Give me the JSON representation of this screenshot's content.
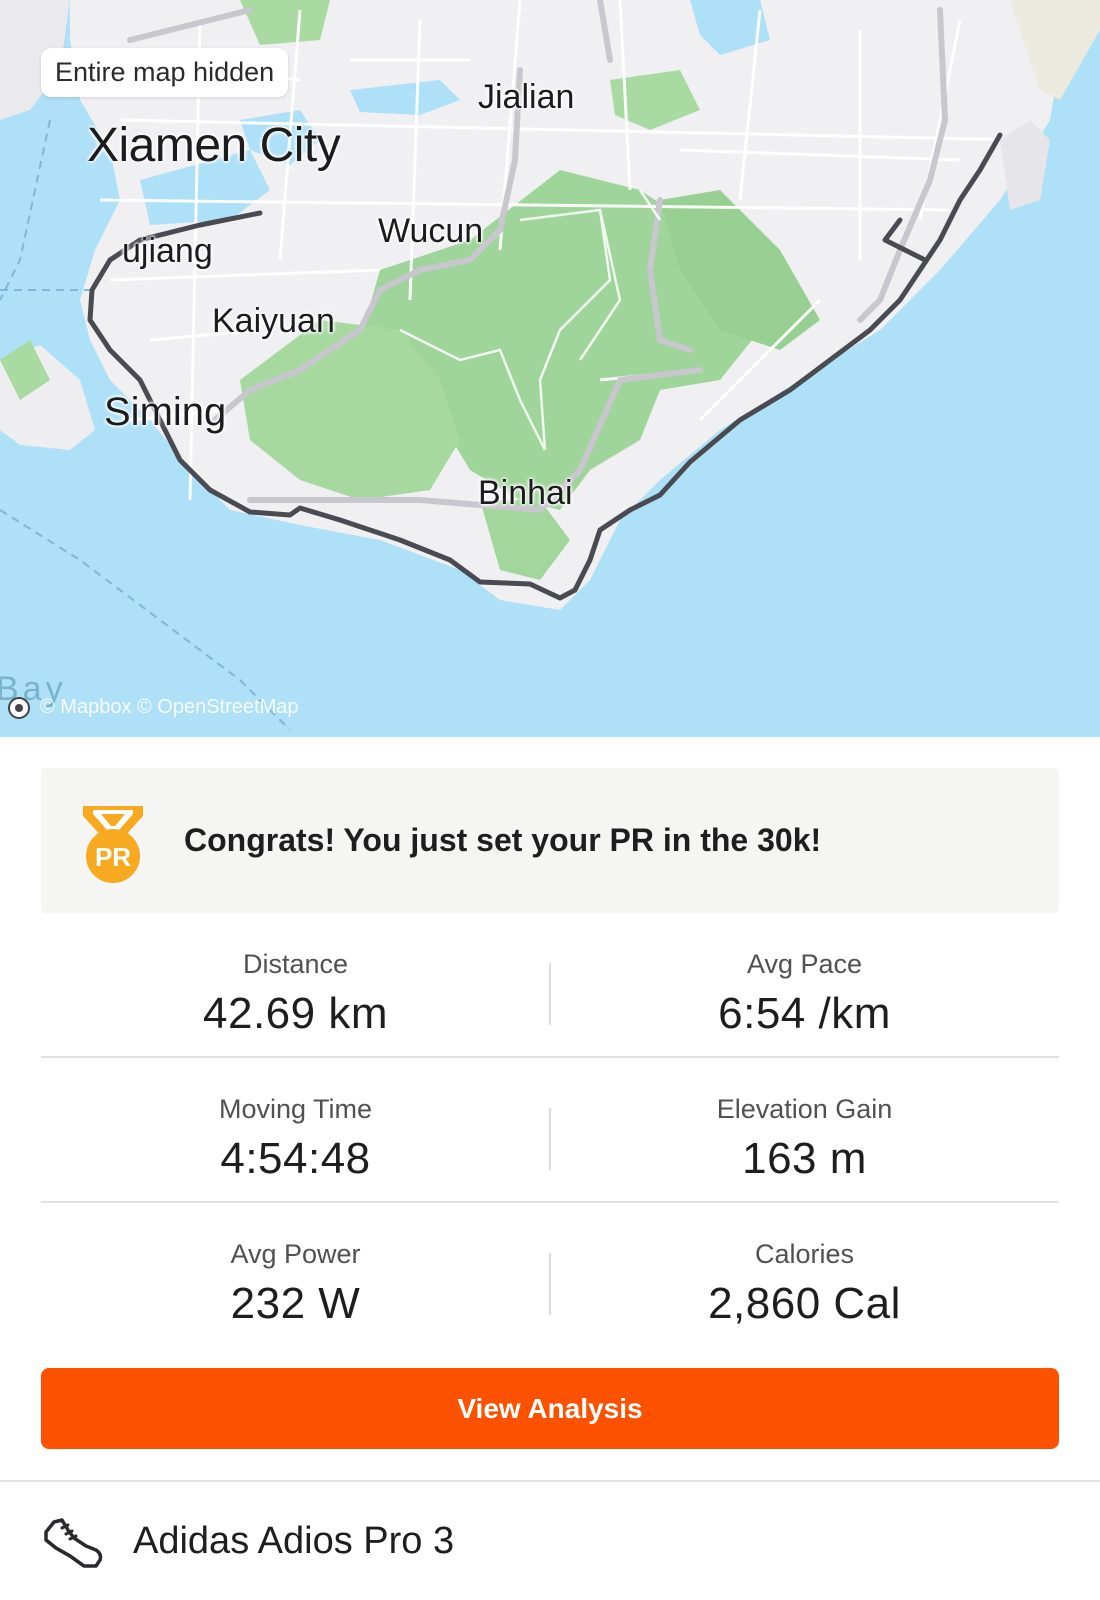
{
  "map": {
    "privacy_chip": "Entire map hidden",
    "labels": {
      "city": "Xiamen City",
      "jialian": "Jialian",
      "wucun": "Wucun",
      "lujiang": "ujiang",
      "kaiyuan": "Kaiyuan",
      "siming": "Siming",
      "binhai": "Binhai",
      "bay": "Bay"
    },
    "attribution": "© Mapbox © OpenStreetMap"
  },
  "pr_banner": {
    "medal_text": "PR",
    "message": "Congrats! You just set your PR in the 30k!"
  },
  "stats": [
    {
      "label": "Distance",
      "value": "42.69 km"
    },
    {
      "label": "Avg Pace",
      "value": "6:54 /km"
    },
    {
      "label": "Moving Time",
      "value": "4:54:48"
    },
    {
      "label": "Elevation Gain",
      "value": "163 m"
    },
    {
      "label": "Avg Power",
      "value": "232 W"
    },
    {
      "label": "Calories",
      "value": "2,860 Cal"
    }
  ],
  "actions": {
    "view_analysis": "View Analysis"
  },
  "gear": {
    "icon": "shoe-icon",
    "name": "Adidas Adios Pro 3"
  },
  "colors": {
    "accent": "#fc5200",
    "medal": "#f7a920",
    "route": "#4a4a52",
    "water": "#aee0f7",
    "park": "#9fd49a"
  }
}
